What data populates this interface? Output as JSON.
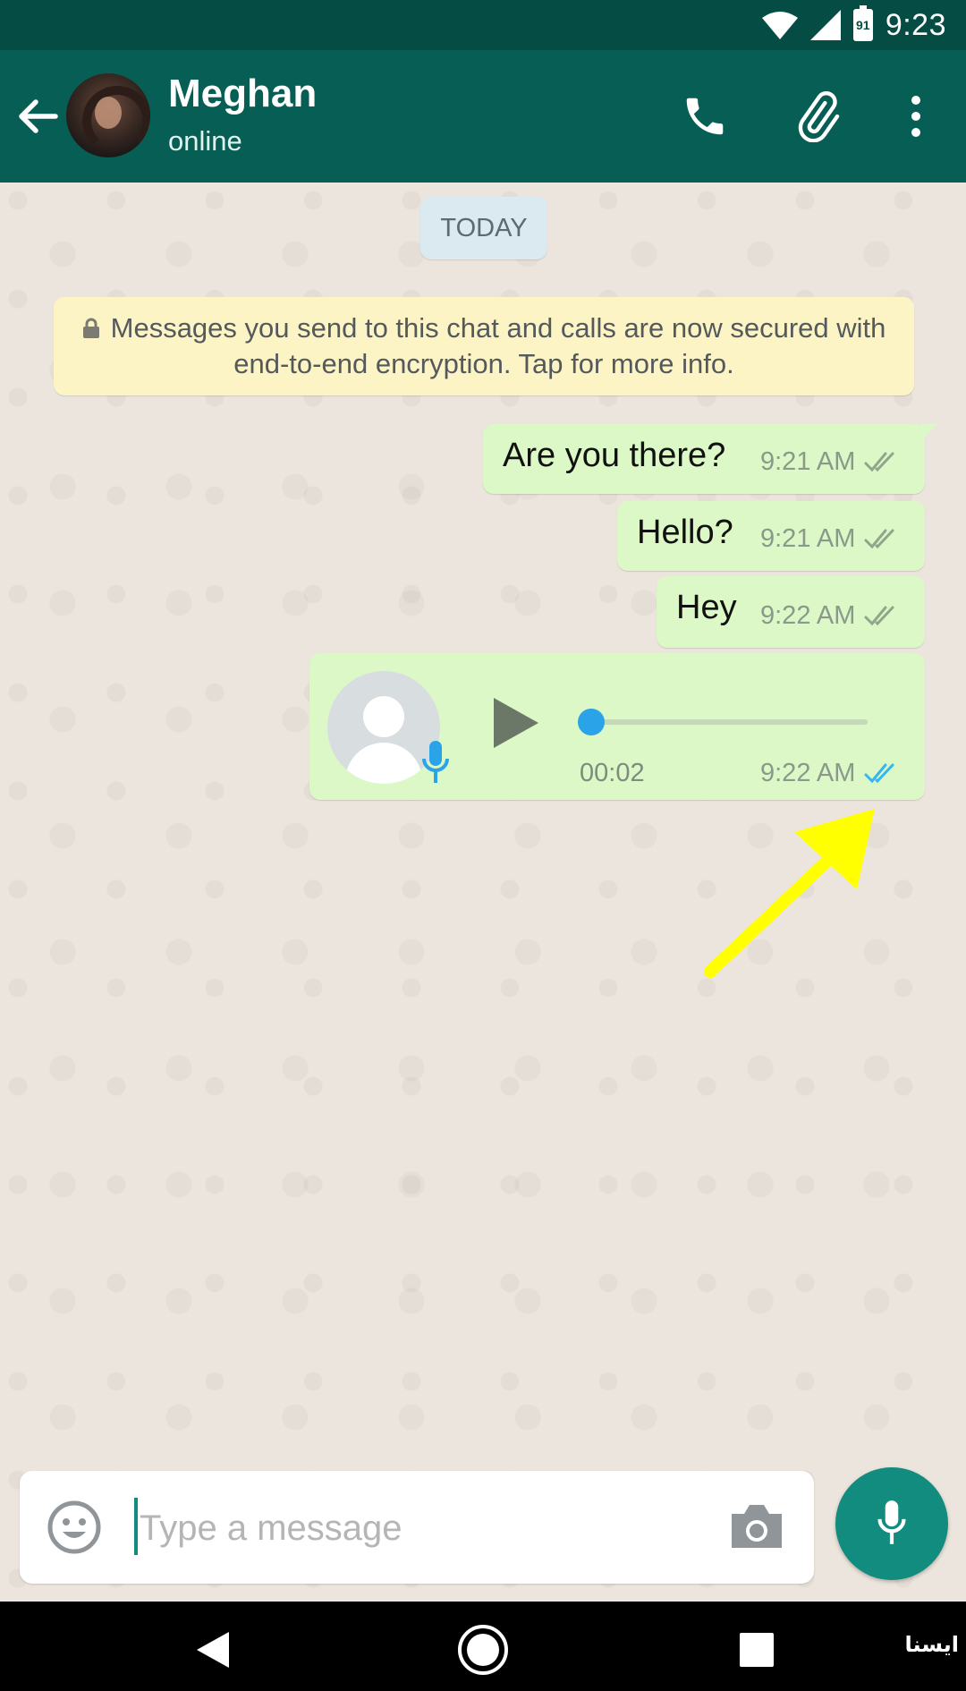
{
  "status_bar": {
    "time": "9:23",
    "battery_level": "91"
  },
  "header": {
    "contact_name": "Meghan",
    "contact_status": "online"
  },
  "icons": {
    "back": "arrow-left-icon",
    "call": "phone-icon",
    "attach": "paperclip-icon",
    "menu": "more-vert-icon",
    "lock": "lock-icon",
    "emoji": "emoji-icon",
    "camera": "camera-icon",
    "mic": "mic-icon"
  },
  "chat": {
    "date_label": "TODAY",
    "encryption_notice": "Messages you send to this chat and calls are now secured with end-to-end encryption. Tap for more info.",
    "messages": [
      {
        "text": "Are you there?",
        "time": "9:21 AM",
        "status": "delivered"
      },
      {
        "text": "Hello?",
        "time": "9:21 AM",
        "status": "delivered"
      },
      {
        "text": "Hey",
        "time": "9:22 AM",
        "status": "delivered"
      }
    ],
    "voice_message": {
      "duration": "00:02",
      "time": "9:22 AM",
      "status": "read",
      "progress": 0
    }
  },
  "input": {
    "placeholder": "Type a message",
    "value": ""
  },
  "watermark": "ایسنا",
  "colors": {
    "header": "#075e54",
    "status_bar": "#054d44",
    "outgoing_bubble": "#dcf8c6",
    "accent": "#128c7e",
    "read_ticks": "#34b7f1",
    "delivered_ticks": "#92a58c",
    "arrow": "#ffff00"
  }
}
